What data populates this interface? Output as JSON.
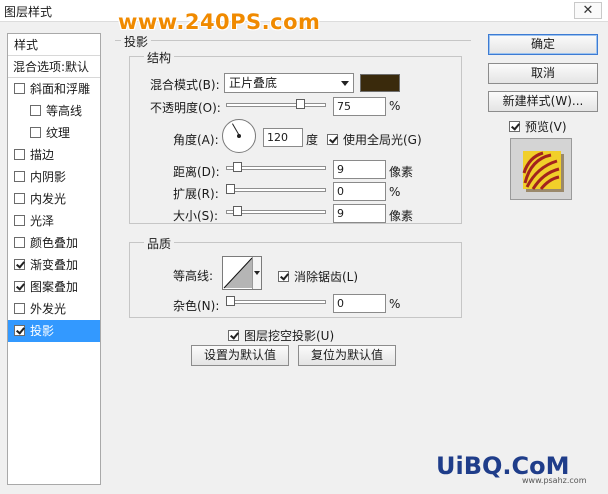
{
  "window": {
    "title": "图层样式",
    "close_glyph": "✕"
  },
  "watermarks": {
    "top": "www.240PS.com",
    "bottom": "UiBQ.CoM",
    "bottom_sub": "www.psahz.com"
  },
  "left_panel": {
    "header_style": "样式",
    "header_blend": "混合选项:默认",
    "items": [
      {
        "label": "斜面和浮雕",
        "checked": false
      },
      {
        "label": "等高线",
        "checked": false
      },
      {
        "label": "纹理",
        "checked": false
      },
      {
        "label": "描边",
        "checked": false
      },
      {
        "label": "内阴影",
        "checked": false
      },
      {
        "label": "内发光",
        "checked": false
      },
      {
        "label": "光泽",
        "checked": false
      },
      {
        "label": "颜色叠加",
        "checked": false
      },
      {
        "label": "渐变叠加",
        "checked": true
      },
      {
        "label": "图案叠加",
        "checked": true
      },
      {
        "label": "外发光",
        "checked": false
      },
      {
        "label": "投影",
        "checked": true
      }
    ]
  },
  "shadow": {
    "title": "投影",
    "structure": {
      "title": "结构",
      "blend_label": "混合模式(B):",
      "blend_value": "正片叠底",
      "shadow_color": "#3a2a0c",
      "opacity_label": "不透明度(O):",
      "opacity_value": "75",
      "opacity_pct": 75,
      "percent": "%",
      "angle_label": "角度(A):",
      "angle_value": "120",
      "degree": "度",
      "global_light_label": "使用全局光(G)",
      "global_light_checked": true,
      "distance_label": "距离(D):",
      "distance_value": "9",
      "pixel_unit": "像素",
      "spread_label": "扩展(R):",
      "spread_value": "0",
      "size_label": "大小(S):",
      "size_value": "9"
    },
    "quality": {
      "title": "品质",
      "contour_label": "等高线:",
      "anti_alias_label": "消除锯齿(L)",
      "anti_alias_checked": true,
      "noise_label": "杂色(N):",
      "noise_value": "0"
    },
    "knockout_label": "图层挖空投影(U)",
    "knockout_checked": true,
    "set_default": "设置为默认值",
    "reset_default": "复位为默认值"
  },
  "actions": {
    "ok": "确定",
    "cancel": "取消",
    "new_style": "新建样式(W)...",
    "preview": "预览(V)",
    "preview_checked": true
  }
}
